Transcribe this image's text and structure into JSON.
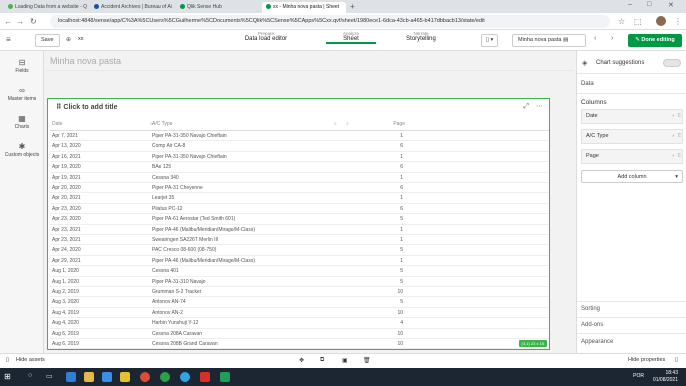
{
  "browser": {
    "tabs": [
      {
        "label": "Loading Data from a website - Q",
        "color": "#4caf50",
        "active": false
      },
      {
        "label": "Accident Archives | Bureau of Ai",
        "color": "#1e4fa0",
        "active": false
      },
      {
        "label": "Qlik Sense Hub",
        "color": "#009845",
        "active": false
      },
      {
        "label": "xx - Minha nova pasta | Sheet",
        "color": "#009845",
        "active": true
      }
    ],
    "url": "localhost:4848/sense/app/C%3A%5CUsers%5CGuilherme%5CDocuments%5CQlik%5CSense%5CApps%5Cxx.qvf/sheet/1980ece1-6dca-43cb-a465-b417dbbacb13/state/edit"
  },
  "toolbar": {
    "save": "Save",
    "app_name": "xx",
    "prepare_small": "Prepare",
    "prepare_big": "Data load editor",
    "analyze_small": "Analyze",
    "analyze_big": "Sheet",
    "narrate_small": "Narrate",
    "narrate_big": "Storytelling",
    "sheet_name": "Minha nova pasta",
    "done": "Done editing"
  },
  "left_panel": {
    "items": [
      {
        "label": "Fields",
        "icon": "fields-icon"
      },
      {
        "label": "Master items",
        "icon": "link-icon"
      },
      {
        "label": "Charts",
        "icon": "chart-icon"
      },
      {
        "label": "Custom objects",
        "icon": "puzzle-icon"
      }
    ]
  },
  "sheet": {
    "title": "Minha nova pasta",
    "object_title": "Click to add title",
    "columns": [
      "Date",
      "A/C Type",
      "Page"
    ],
    "rows": [
      [
        "Apr 7, 2021",
        "Piper PA-31-350 Navajo Chieftain",
        "1"
      ],
      [
        "Apr 13, 2020",
        "Comp Air CA-8",
        "6"
      ],
      [
        "Apr 16, 2021",
        "Piper PA-31-350 Navajo Chieftain",
        "1"
      ],
      [
        "Apr 19, 2020",
        "BAe 125",
        "6"
      ],
      [
        "Apr 19, 2021",
        "Cessna 340",
        "1"
      ],
      [
        "Apr 20, 2020",
        "Piper PA-31 Cheyenne",
        "6"
      ],
      [
        "Apr 20, 2021",
        "Learjet 35",
        "1"
      ],
      [
        "Apr 23, 2020",
        "Pilatus PC-12",
        "6"
      ],
      [
        "Apr 23, 2020",
        "Piper PA-61 Aerostar (Ted Smith 601)",
        "5"
      ],
      [
        "Apr 23, 2021",
        "Piper PA-46 (Malibu/Meridian/Mirage/M-Class)",
        "1"
      ],
      [
        "Apr 23, 2021",
        "Swearingen SA226T Merlin III",
        "1"
      ],
      [
        "Apr 24, 2020",
        "PAC Cresco 08-600 (08-750)",
        "5"
      ],
      [
        "Apr 29, 2021",
        "Piper PA-46 (Malibu/Meridian/Mirage/M-Class)",
        "1"
      ],
      [
        "Aug 1, 2020",
        "Cessna 401",
        "5"
      ],
      [
        "Aug 1, 2020",
        "Piper PA-31-310 Navajo",
        "5"
      ],
      [
        "Aug 2, 2019",
        "Grumman S-2 Tracker",
        "10"
      ],
      [
        "Aug 3, 2020",
        "Antonov AN-74",
        "5"
      ],
      [
        "Aug 4, 2019",
        "Antonov AN-2",
        "10"
      ],
      [
        "Aug 4, 2020",
        "Harbin Yunshuji Y-12",
        "4"
      ],
      [
        "Aug 6, 2019",
        "Cessna 208A Caravan",
        "10"
      ],
      [
        "Aug 6, 2019",
        "Cessna 208B Grand Caravan",
        "10"
      ]
    ],
    "badge": "(3,1) 23 x 15"
  },
  "right_panel": {
    "chart_suggestions": "Chart suggestions",
    "data_tab": "Data",
    "columns_heading": "Columns",
    "fields": [
      "Date",
      "A/C Type",
      "Page"
    ],
    "add_column": "Add column",
    "sorting": "Sorting",
    "addons": "Add-ons",
    "appearance": "Appearance"
  },
  "bottom_bar": {
    "hide_assets": "Hide assets",
    "hide_properties": "Hide properties"
  },
  "taskbar": {
    "lang": "POR",
    "time": "18:43",
    "date": "01/08/2021"
  }
}
